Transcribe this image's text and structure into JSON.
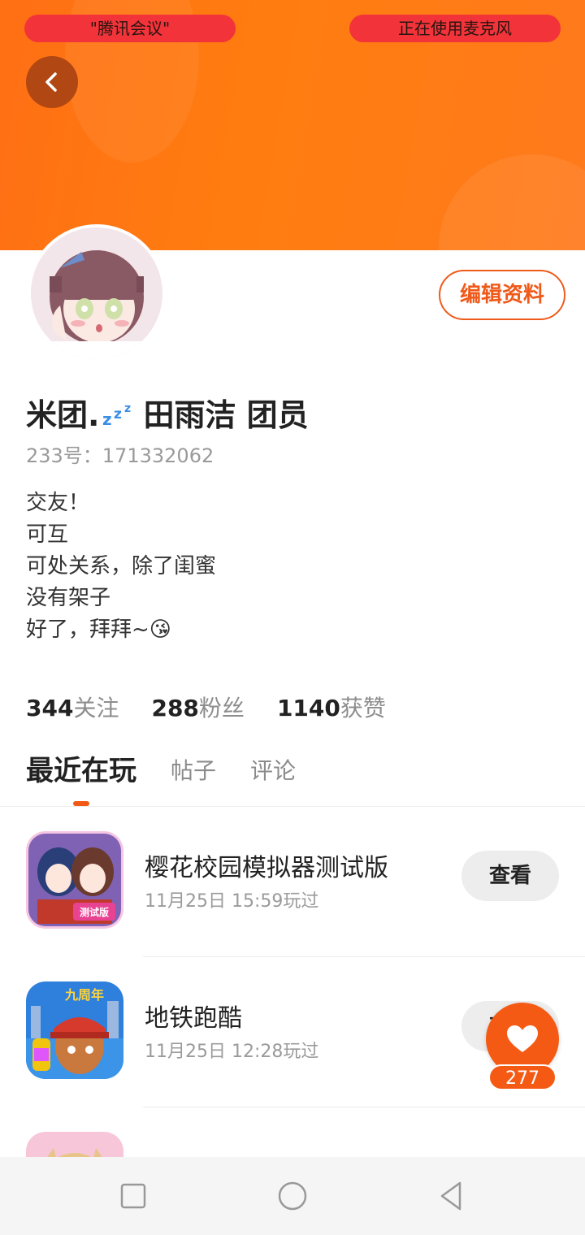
{
  "status_pills": {
    "left": "\"腾讯会议\"",
    "right": "正在使用麦克风"
  },
  "profile": {
    "name_prefix": "米团.",
    "name_suffix": "田雨洁 团员",
    "edit_label": "编辑资料",
    "uid": "233号：171332062",
    "bio": [
      "交友！",
      "可互",
      "可处关系，除了闺蜜",
      "没有架子",
      "好了，拜拜~😘"
    ]
  },
  "stats": [
    {
      "num": "344",
      "label": "关注"
    },
    {
      "num": "288",
      "label": "粉丝"
    },
    {
      "num": "1140",
      "label": "获赞"
    }
  ],
  "tabs": [
    "最近在玩",
    "帖子",
    "评论"
  ],
  "games": [
    {
      "title": "樱花校园模拟器测试版",
      "time": "11月25日 15:59玩过",
      "action": "查看"
    },
    {
      "title": "地铁跑酷",
      "time": "11月25日 12:28玩过",
      "action": "查看"
    },
    {
      "title": "",
      "time": "",
      "action": ""
    }
  ],
  "like": {
    "count": "277"
  },
  "colors": {
    "accent": "#f45a14",
    "header": "#ff7a12",
    "pill": "#f2333a"
  },
  "icons": {
    "back": "chevron-left-icon",
    "like": "heart-icon",
    "nav": [
      "square-icon",
      "circle-icon",
      "triangle-back-icon"
    ]
  }
}
